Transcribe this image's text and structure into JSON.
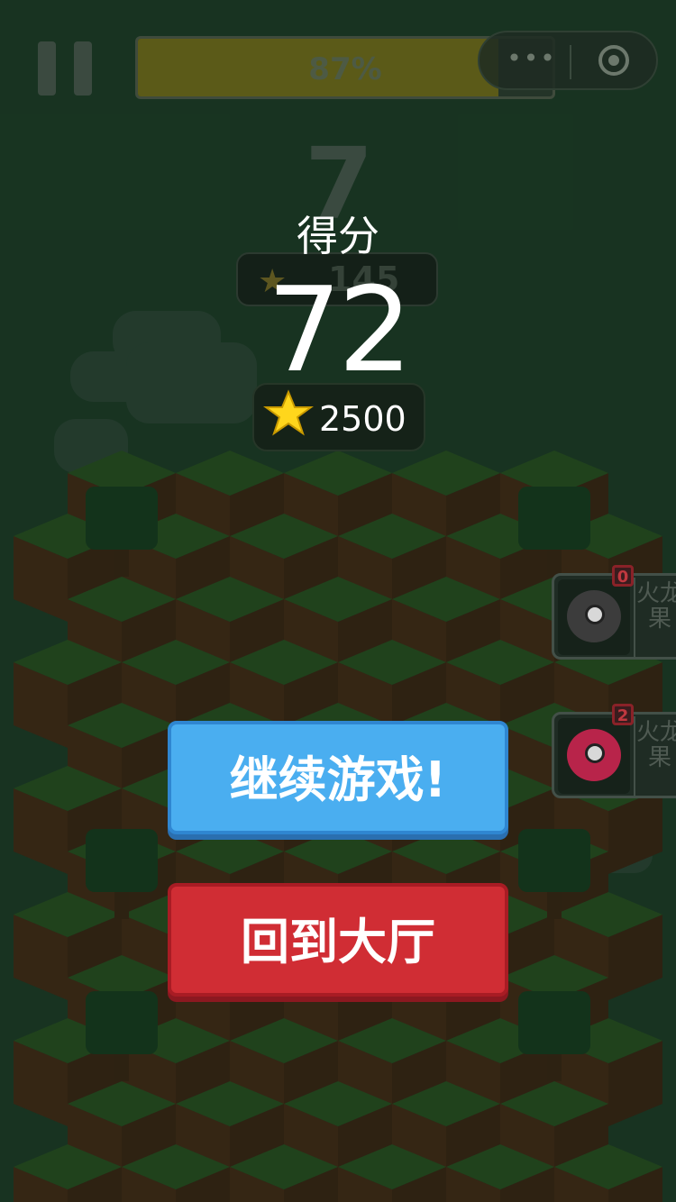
{
  "hud": {
    "progress_text": "87%",
    "progress_value": 0.87,
    "menu_icon": "more-dots-icon",
    "close_icon": "target-icon"
  },
  "background": {
    "level_digit": "7",
    "best_value": "145"
  },
  "result": {
    "score_label": "得分",
    "score_value": "72",
    "coins_value": "2500"
  },
  "side_cards": [
    {
      "count": "0",
      "name": "火龙果",
      "color": "#3c3c3c"
    },
    {
      "count": "2",
      "name": "火龙果",
      "color": "#b8244a"
    }
  ],
  "buttons": {
    "continue_label": "继续游戏!",
    "lobby_label": "回到大厅"
  },
  "colors": {
    "continue": "#4aaef0",
    "lobby": "#d02d34",
    "grass": "#3c7a2e",
    "dirt": "#5b3318"
  }
}
